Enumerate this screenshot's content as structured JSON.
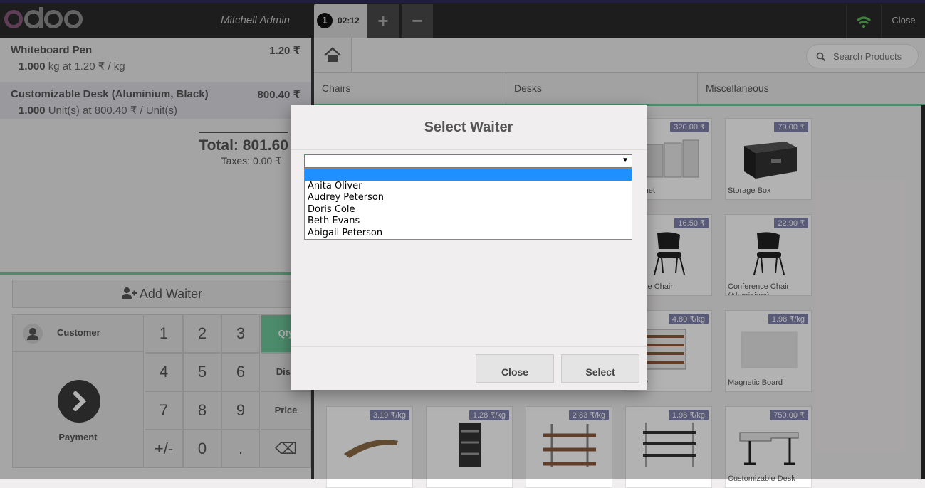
{
  "header": {
    "logo_text": "odoo",
    "user_name": "Mitchell Admin",
    "order_tab": {
      "number": "1",
      "time": "02:12"
    },
    "add_order_symbol": "+",
    "remove_order_symbol": "−",
    "close_label": "Close"
  },
  "order": {
    "lines": [
      {
        "name": "Whiteboard Pen",
        "price": "1.20 ₹",
        "qty": "1.000",
        "detail": " kg at 1.20 ₹ / kg"
      },
      {
        "name": "Customizable Desk (Aluminium, Black)",
        "price": "800.40 ₹",
        "qty": "1.000",
        "detail": " Unit(s) at 800.40 ₹ / Unit(s)"
      }
    ],
    "total_label": "Total: 801.60",
    "taxes_label": "Taxes: 0.00 ₹"
  },
  "actions": {
    "add_waiter_label": "Add Waiter",
    "customer_label": "Customer",
    "payment_label": "Payment"
  },
  "numpad": {
    "keys": [
      "1",
      "2",
      "3",
      "4",
      "5",
      "6",
      "7",
      "8",
      "9",
      "+/-",
      "0",
      "."
    ],
    "modes": [
      "Qty",
      "Disc",
      "Price"
    ],
    "backspace_symbol": "⌫"
  },
  "products_header": {
    "search_placeholder": "Search Products",
    "categories": [
      "Chairs",
      "Desks",
      "Miscellaneous"
    ]
  },
  "products": [
    {
      "name": "Cabinet",
      "price": "320.00 ₹"
    },
    {
      "name": "Storage Box",
      "price": "79.00 ₹"
    },
    {
      "name": "erence Chair",
      "price": "16.50 ₹"
    },
    {
      "name": "Conference Chair (Aluminium)",
      "price": "22.90 ₹"
    },
    {
      "name": "r Tray",
      "price": "4.80 ₹/kg"
    },
    {
      "name": "Magnetic Board",
      "price": "1.98 ₹/kg"
    },
    {
      "name": "",
      "price": "3.19 ₹/kg"
    },
    {
      "name": "",
      "price": "1.28 ₹/kg"
    },
    {
      "name": "",
      "price": "2.83 ₹/kg"
    },
    {
      "name": "",
      "price": "1.98 ₹/kg"
    },
    {
      "name": "Customizable Desk",
      "price": "750.00 ₹"
    }
  ],
  "modal": {
    "title": "Select Waiter",
    "options": [
      "",
      "Anita Oliver",
      "Audrey Peterson",
      "Doris Cole",
      "Beth Evans",
      "Abigail Peterson"
    ],
    "close_label": "Close",
    "select_label": "Select"
  },
  "colors": {
    "accent": "#6ec89b",
    "highlight": "#1e90ff",
    "price_tag": "#7f82ac"
  }
}
